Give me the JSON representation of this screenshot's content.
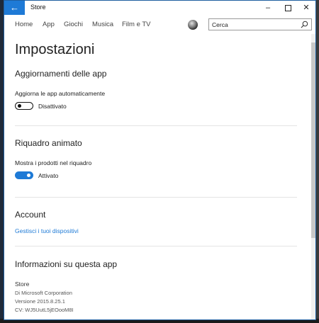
{
  "window": {
    "title": "Store"
  },
  "nav": {
    "items": [
      "Home",
      "App",
      "Giochi",
      "Musica",
      "Film e TV"
    ]
  },
  "search": {
    "value": "Cerca"
  },
  "page": {
    "title": "Impostazioni"
  },
  "sections": {
    "updates": {
      "title": "Aggiornamenti delle app",
      "label": "Aggiorna le app automaticamente",
      "state": "Disattivato",
      "on": false
    },
    "live_tile": {
      "title": "Riquadro animato",
      "label": "Mostra i prodotti nel riquadro",
      "state": "Attivato",
      "on": true
    },
    "account": {
      "title": "Account",
      "link": "Gestisci i tuoi dispositivi"
    },
    "about": {
      "title": "Informazioni su questa app",
      "lines": [
        "Store",
        "Di Microsoft Corporation",
        "Versione 2015.8.25.1",
        "CV: WJ5UutL5jEOooM8I"
      ]
    }
  },
  "colors": {
    "accent": "#1e7ad6"
  },
  "icons": {
    "back": "arrow-left",
    "search": "magnifier"
  }
}
